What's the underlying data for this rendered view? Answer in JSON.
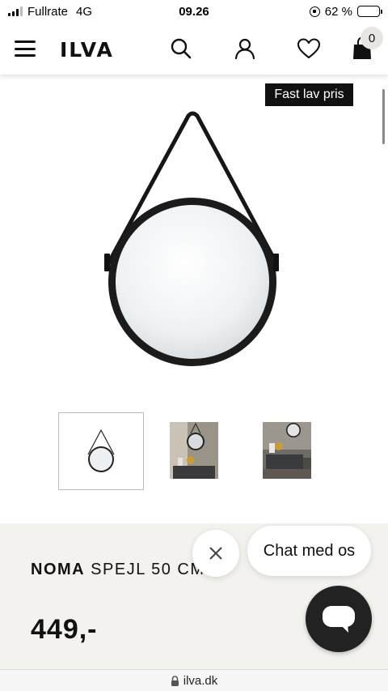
{
  "status_bar": {
    "carrier": "Fullrate",
    "network": "4G",
    "time": "09.26",
    "battery": "62 %",
    "battery_level": 0.62
  },
  "header": {
    "logo": "ILVA",
    "cart_count": "0",
    "icons": [
      "menu-icon",
      "search-icon",
      "account-icon",
      "heart-icon",
      "cart-icon"
    ]
  },
  "badge": {
    "label": "Fast lav pris"
  },
  "product": {
    "brand": "NOMA",
    "name": "SPEJL 50 CM",
    "price": "449,-"
  },
  "thumbnails": [
    "mirror-product",
    "mirror-room-1",
    "mirror-room-2"
  ],
  "chat": {
    "label": "Chat med os"
  },
  "browser": {
    "url": "ilva.dk"
  },
  "colors": {
    "badge_bg": "#111111",
    "panel_bg": "#f3f2ef",
    "chat_launcher": "#222222"
  }
}
